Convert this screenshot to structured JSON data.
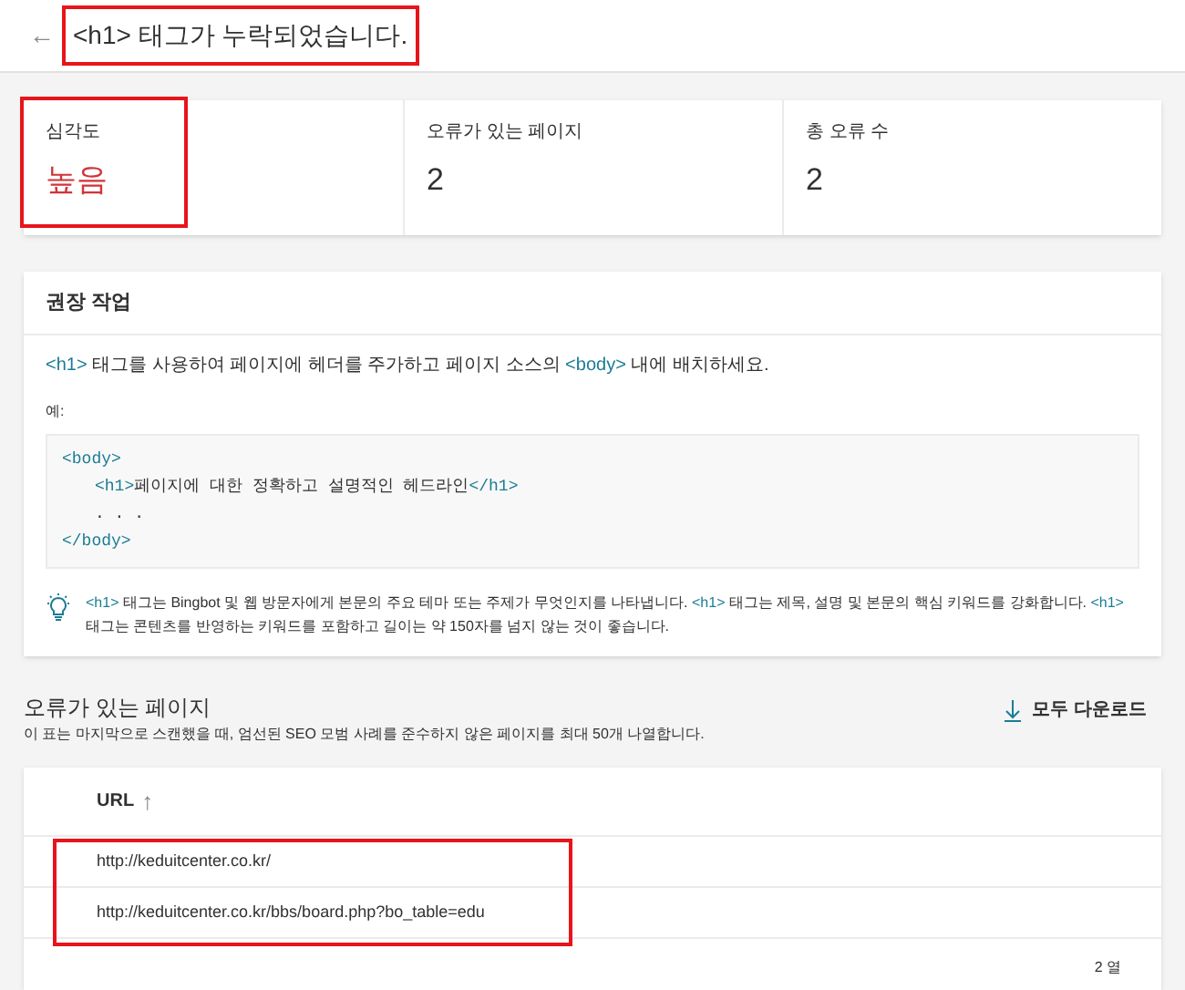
{
  "header": {
    "back": "←",
    "title": "<h1> 태그가 누락되었습니다.",
    "highlighted": true
  },
  "stats": [
    {
      "label": "심각도",
      "value": "높음",
      "severity": true,
      "highlighted": true
    },
    {
      "label": "오류가 있는 페이지",
      "value": "2",
      "severity": false,
      "highlighted": false
    },
    {
      "label": "총 오류 수",
      "value": "2",
      "severity": false,
      "highlighted": false
    }
  ],
  "recommendation": {
    "title": "권장 작업",
    "instruction": [
      {
        "kind": "code",
        "text": "<h1>"
      },
      {
        "kind": "plain",
        "text": " 태그를 사용하여 페이지에 헤더를 주가하고 페이지 소스의 "
      },
      {
        "kind": "code",
        "text": "<body>"
      },
      {
        "kind": "plain",
        "text": " 내에 배치하세요."
      }
    ],
    "example_label": "예:",
    "code_lines": [
      {
        "indented": false,
        "segments": [
          {
            "kind": "code",
            "text": "<body>"
          }
        ]
      },
      {
        "indented": true,
        "segments": [
          {
            "kind": "code",
            "text": "<h1>"
          },
          {
            "kind": "plain",
            "text": "페이지에 대한 정확하고 설명적인 헤드라인"
          },
          {
            "kind": "code",
            "text": "</h1>"
          }
        ]
      },
      {
        "indented": true,
        "segments": [
          {
            "kind": "plain",
            "text": ". . ."
          }
        ]
      },
      {
        "indented": false,
        "segments": [
          {
            "kind": "code",
            "text": "</body>"
          }
        ]
      }
    ],
    "tip": [
      {
        "kind": "code",
        "text": "<h1>"
      },
      {
        "kind": "plain",
        "text": " 태그는 Bingbot 및 웹 방문자에게 본문의 주요 테마 또는 주제가 무엇인지를 나타냅니다. "
      },
      {
        "kind": "code",
        "text": "<h1>"
      },
      {
        "kind": "plain",
        "text": " 태그는 제목, 설명 및 본문의 핵심 키워드를 강화합니다. "
      },
      {
        "kind": "code",
        "text": "<h1>"
      },
      {
        "kind": "plain",
        "text": " 태그는 콘텐츠를 반영하는 키워드를 포함하고 길이는 약 150자를 넘지 않는 것이 좋습니다."
      }
    ]
  },
  "pages": {
    "title": "오류가 있는 페이지",
    "description": "이 표는 마지막으로 스캔했을 때, 엄선된 SEO 모범 사례를 준수하지 않은 페이지를 최대 50개 나열합니다.",
    "download": "모두 다운로드",
    "column": "URL",
    "sort": "↑",
    "rows_highlighted": true,
    "rows": [
      "http://keduitcenter.co.kr/",
      "http://keduitcenter.co.kr/bbs/board.php?bo_table=edu"
    ],
    "footer": "2 열"
  }
}
